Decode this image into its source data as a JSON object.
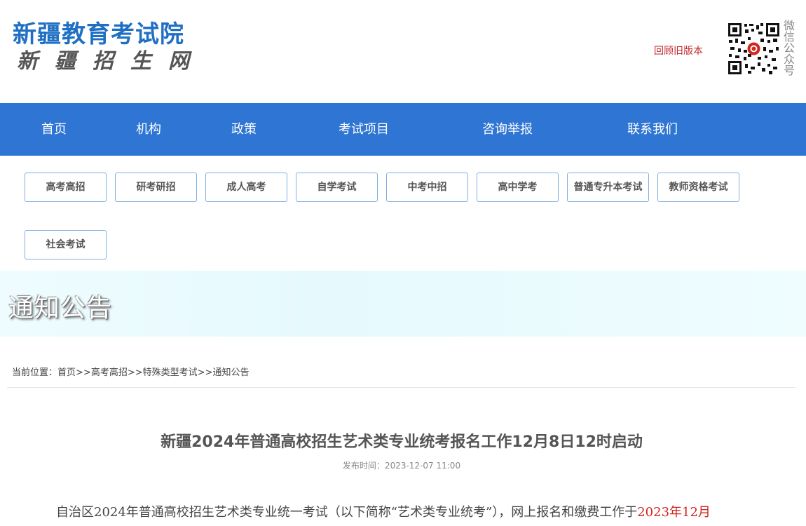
{
  "header": {
    "logo_main": "新疆教育考试院",
    "logo_sub": "新疆招生网",
    "old_version": "回顾旧版本",
    "qr_label": "微信公众号"
  },
  "nav": {
    "items": [
      "首页",
      "机构",
      "政策",
      "考试项目",
      "咨询举报",
      "联系我们"
    ]
  },
  "subnav": {
    "items": [
      "高考高招",
      "研考研招",
      "成人高考",
      "自学考试",
      "中考中招",
      "高中学考",
      "普通专升本考试",
      "教师资格考试",
      "社会考试"
    ]
  },
  "banner": {
    "title": "通知公告"
  },
  "breadcrumb": {
    "prefix": "当前位置：",
    "items": [
      "首页",
      "高考高招",
      "特殊类型考试",
      "通知公告"
    ],
    "separator": ">>"
  },
  "article": {
    "title": "新疆2024年普通高校招生艺术类专业统考报名工作12月8日12时启动",
    "meta_label": "发布时间：",
    "meta_date": "2023-12-07 11:00",
    "body_text": "自治区2024年普通高校招生艺术类专业统一考试（以下简称“艺术类专业统考”），网上报名和缴费工作于",
    "body_highlight": "2023年12月"
  },
  "colors": {
    "brand_blue": "#1f6fc3",
    "nav_blue": "#2f75d3",
    "accent_red": "#c0282e",
    "button_border": "#7fb0e0"
  }
}
